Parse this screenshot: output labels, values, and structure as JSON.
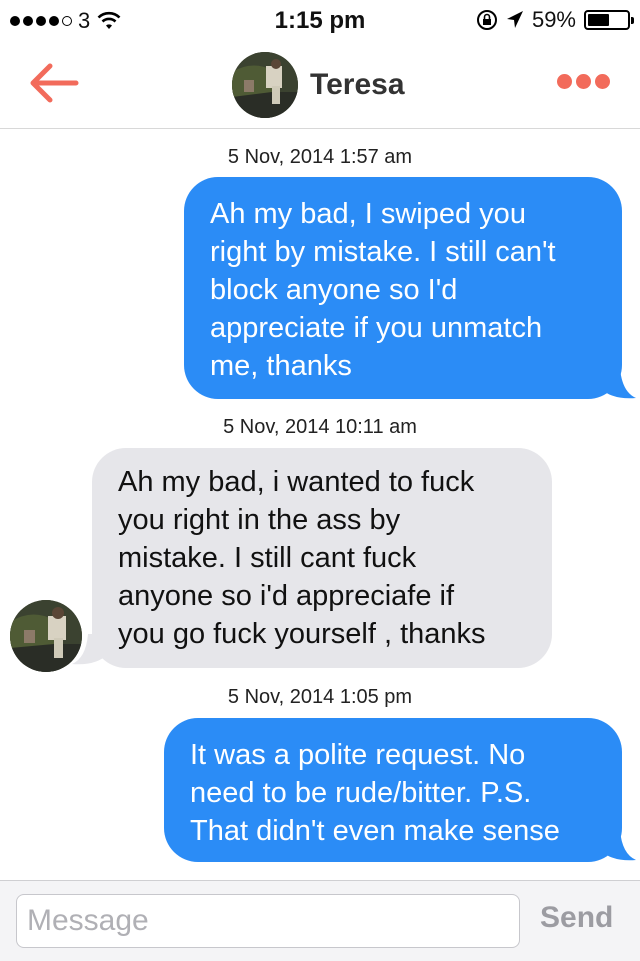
{
  "status_bar": {
    "carrier": "3",
    "time": "1:15 pm",
    "battery": "59%",
    "battery_level": 0.59
  },
  "header": {
    "contact_name": "Teresa",
    "accent_color": "#f26b5b",
    "icons": [
      "back-arrow-icon",
      "avatar",
      "more-options-icon"
    ]
  },
  "messages": [
    {
      "timestamp": "5 Nov, 2014 1:57 am",
      "direction": "outgoing",
      "text": "Ah my bad, I swiped you\nright by mistake. I still can't\nblock anyone so I'd\nappreciate if you unmatch\nme, thanks"
    },
    {
      "timestamp": "5 Nov, 2014 10:11 am",
      "direction": "incoming",
      "text": "Ah my bad, i wanted to fuck\nyou right in the ass by\nmistake. I still cant fuck\nanyone so i'd appreciafe if\nyou go fuck yourself , thanks"
    },
    {
      "timestamp": "5 Nov, 2014 1:05 pm",
      "direction": "outgoing",
      "text": "It was a polite request. No\nneed to be rude/bitter. P.S.\nThat didn't even make sense"
    }
  ],
  "composer": {
    "placeholder": "Message",
    "send_label": "Send"
  },
  "colors": {
    "outgoing_bubble": "#2b8cf6",
    "incoming_bubble": "#e6e6ea"
  }
}
